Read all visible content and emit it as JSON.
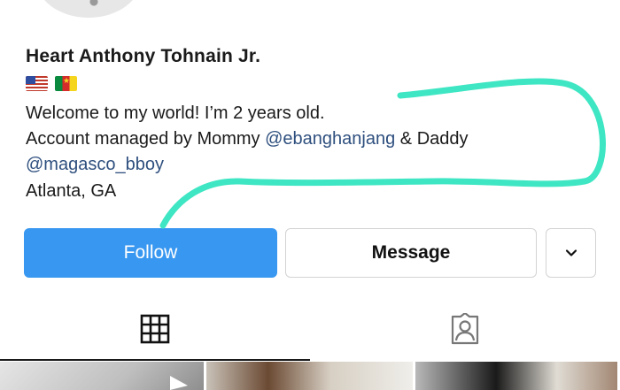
{
  "profile": {
    "name": "Heart Anthony Tohnain Jr.",
    "flags": [
      "us-flag",
      "cameroon-flag"
    ],
    "bio_line1": "Welcome to my world! I’m 2 years old.",
    "bio_line2_prefix": "Account managed by Mommy ",
    "bio_line2_mention": "@ebanghanjang",
    "bio_line2_suffix": " & Daddy",
    "bio_line3_mention": "@magasco_bboy",
    "location": "Atlanta, GA"
  },
  "actions": {
    "follow_label": "Follow",
    "message_label": "Message",
    "more_icon": "chevron-down-icon"
  },
  "tabs": {
    "grid_icon": "grid-icon",
    "tagged_icon": "tagged-person-icon"
  },
  "colors": {
    "follow_button": "#3897f0",
    "mention": "#2e4f7e",
    "scribble": "#3ee6c3"
  }
}
